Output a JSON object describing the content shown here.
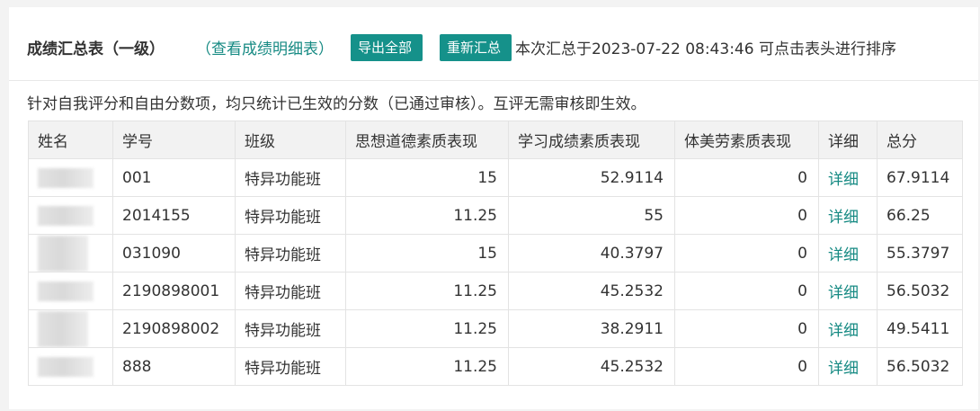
{
  "header": {
    "title": "成绩汇总表（一级）",
    "detail_link": "（查看成绩明细表）",
    "export_button": "导出全部",
    "recalc_button": "重新汇总",
    "summary_text": "本次汇总于2023-07-22 08:43:46 可点击表头进行排序"
  },
  "note": "针对自我评分和自由分数项，均只统计已生效的分数（已通过审核）。互评无需审核即生效。",
  "table": {
    "columns": [
      "姓名",
      "学号",
      "班级",
      "思想道德素质表现",
      "学习成绩素质表现",
      "体美劳素质表现",
      "详细",
      "总分"
    ],
    "rows": [
      {
        "name": "",
        "id": "001",
        "class": "特异功能班",
        "moral": "15",
        "study": "52.9114",
        "pe": "0",
        "detail": "详细",
        "total": "67.9114"
      },
      {
        "name": "",
        "id": "2014155",
        "class": "特异功能班",
        "moral": "11.25",
        "study": "55",
        "pe": "0",
        "detail": "详细",
        "total": "66.25"
      },
      {
        "name": "",
        "id": "031090",
        "class": "特异功能班",
        "moral": "15",
        "study": "40.3797",
        "pe": "0",
        "detail": "详细",
        "total": "55.3797"
      },
      {
        "name": "",
        "id": "2190898001",
        "class": "特异功能班",
        "moral": "11.25",
        "study": "45.2532",
        "pe": "0",
        "detail": "详细",
        "total": "56.5032"
      },
      {
        "name": "",
        "id": "2190898002",
        "class": "特异功能班",
        "moral": "11.25",
        "study": "38.2911",
        "pe": "0",
        "detail": "详细",
        "total": "49.5411"
      },
      {
        "name": "",
        "id": "888",
        "class": "特异功能班",
        "moral": "11.25",
        "study": "45.2532",
        "pe": "0",
        "detail": "详细",
        "total": "56.5032"
      }
    ]
  },
  "colors": {
    "accent": "#15918a",
    "link": "#168a83",
    "header_bg": "#f2f2f2",
    "page_bg": "#f3f3f3"
  }
}
